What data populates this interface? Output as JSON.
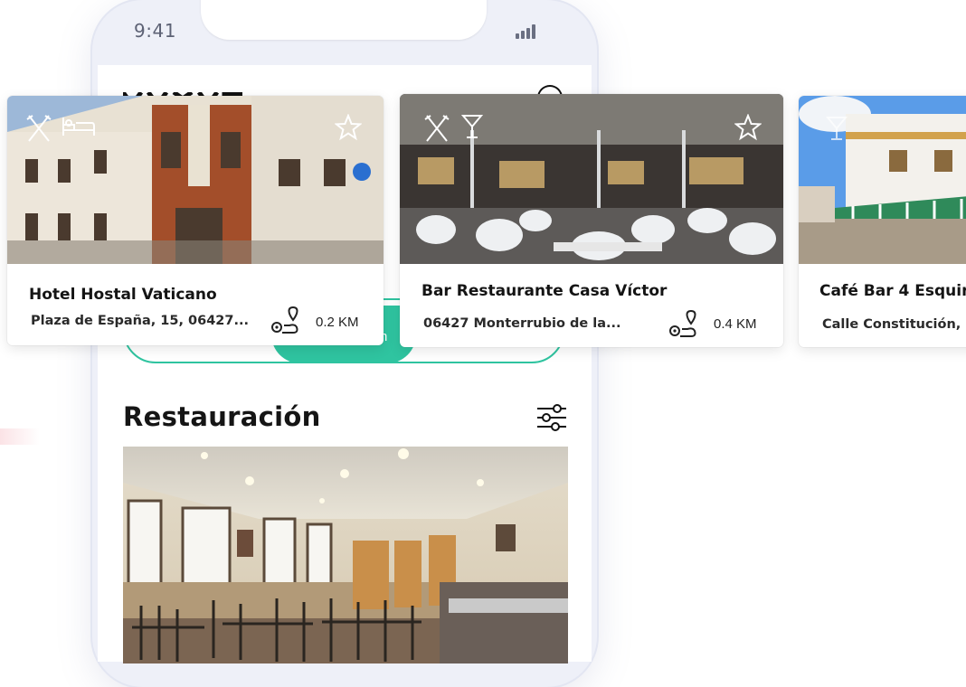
{
  "status_bar": {
    "time": "9:41"
  },
  "toggle": {
    "active_label": "n"
  },
  "section": {
    "title": "Restauración"
  },
  "cards": [
    {
      "name": "Hotel Hostal Vaticano",
      "address": "Plaza de España, 15, 06427...",
      "distance": "0.2 KM",
      "categories": [
        "cutlery-icon",
        "bed-icon"
      ]
    },
    {
      "name": "Bar Restaurante Casa Víctor",
      "address": "06427 Monterrubio de la...",
      "distance": "0.4 KM",
      "categories": [
        "cutlery-icon",
        "cocktail-icon"
      ]
    },
    {
      "name": "Café Bar 4 Esquin",
      "address": "Calle Constitución,",
      "distance": "",
      "categories": [
        "cocktail-icon"
      ]
    }
  ],
  "colors": {
    "accent": "#2fc4a0",
    "frame": "#eef0f8"
  }
}
